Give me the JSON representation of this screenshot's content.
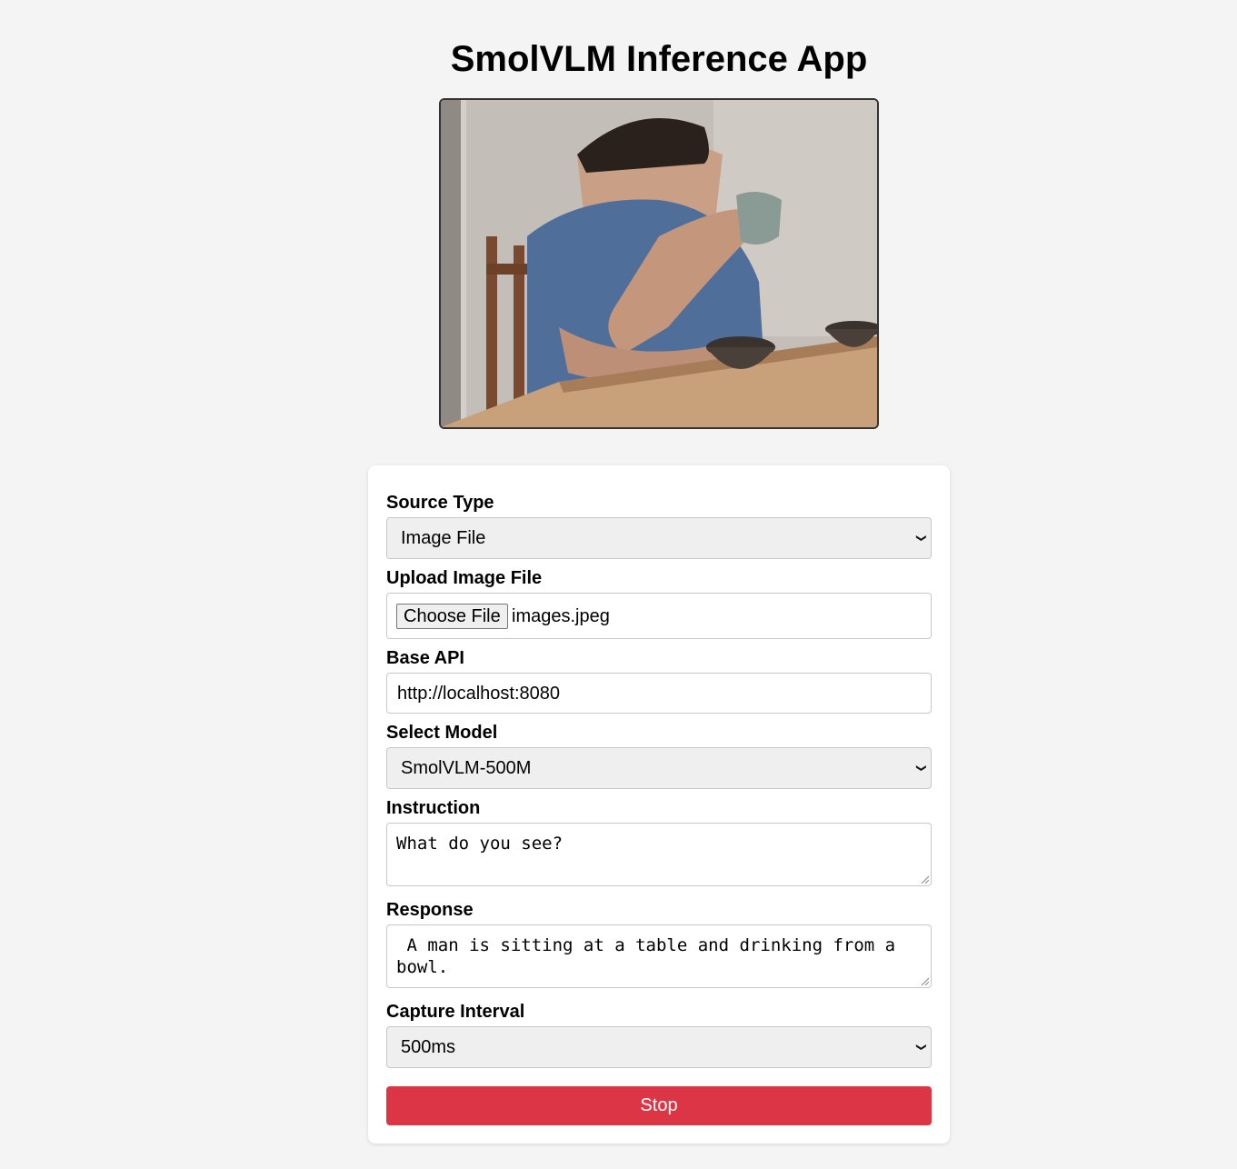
{
  "page": {
    "title": "SmolVLM Inference App"
  },
  "form": {
    "source_type": {
      "label": "Source Type",
      "value": "Image File"
    },
    "upload": {
      "label": "Upload Image File",
      "button_label": "Choose File",
      "file_name": "images.jpeg"
    },
    "base_api": {
      "label": "Base API",
      "value": "http://localhost:8080"
    },
    "model": {
      "label": "Select Model",
      "value": "SmolVLM-500M"
    },
    "instruction": {
      "label": "Instruction",
      "value": "What do you see?"
    },
    "response": {
      "label": "Response",
      "value": " A man is sitting at a table and drinking from a bowl."
    },
    "capture_interval": {
      "label": "Capture Interval",
      "value": "500ms"
    },
    "stop_button": {
      "label": "Stop"
    }
  },
  "colors": {
    "page_background": "#f4f4f4",
    "stop_button": "#dc3545",
    "select_background": "#efefef"
  },
  "icons": {
    "dropdown": "chevron-down-icon",
    "resize": "resize-grip-icon"
  }
}
